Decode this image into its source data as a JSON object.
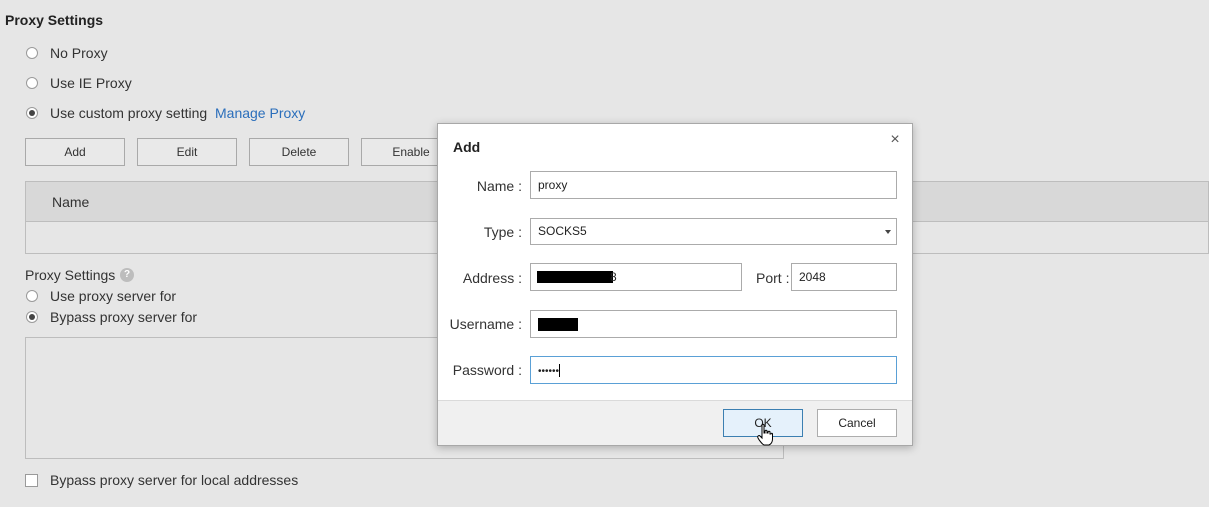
{
  "page": {
    "section_title": "Proxy Settings",
    "options": [
      {
        "label": "No Proxy",
        "checked": false
      },
      {
        "label": "Use IE Proxy",
        "checked": false
      },
      {
        "label": "Use custom proxy setting",
        "checked": true
      }
    ],
    "manage_proxy_link": "Manage Proxy",
    "toolbar": {
      "add": "Add",
      "edit": "Edit",
      "delete": "Delete",
      "enable": "Enable"
    },
    "table": {
      "columns": [
        "Name"
      ]
    },
    "proxy_settings_label": "Proxy Settings",
    "help_icon": "?",
    "server_options": [
      {
        "label": "Use proxy server for",
        "checked": false
      },
      {
        "label": "Bypass proxy server for",
        "checked": true
      }
    ],
    "bypass_local_label": "Bypass proxy server for local addresses"
  },
  "dialog": {
    "title": "Add",
    "close_icon": "×",
    "name_label": "Name :",
    "name_value": "proxy",
    "type_label": "Type :",
    "type_value": "SOCKS5",
    "address_label": "Address :",
    "address_tail": "8",
    "port_label": "Port :",
    "port_value": "2048",
    "username_label": "Username :",
    "password_label": "Password :",
    "password_mask": "••••••",
    "ok_label": "OK",
    "cancel_label": "Cancel"
  },
  "colors": {
    "link": "#2a6ebb",
    "focus": "#5aa0d6",
    "ok_bg": "#e5f1fb"
  }
}
